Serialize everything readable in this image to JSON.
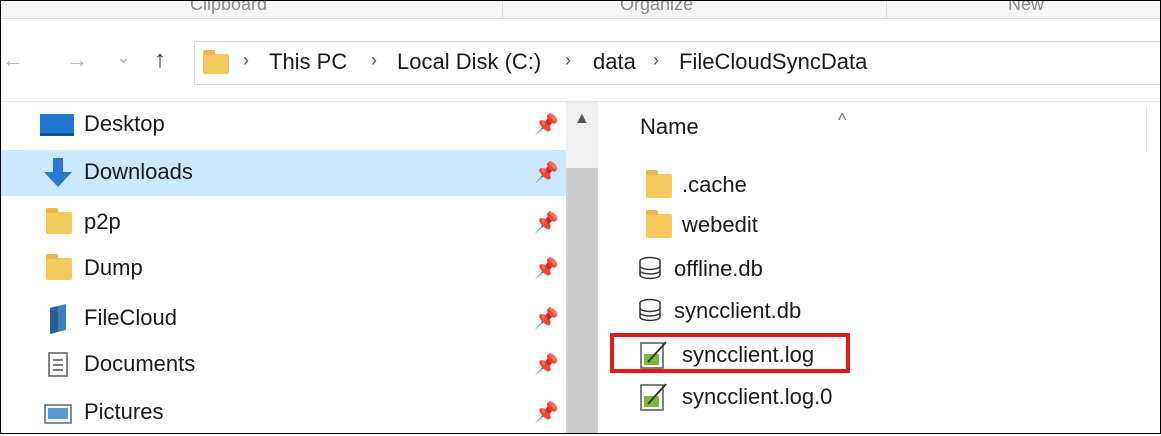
{
  "ribbon": {
    "groups": [
      "Clipboard",
      "Organize",
      "New"
    ]
  },
  "address_bar": {
    "crumbs": [
      "This PC",
      "Local Disk (C:)",
      "data",
      "FileCloudSyncData"
    ],
    "separator": "›"
  },
  "nav": {
    "back_icon": "←",
    "forward_icon": "→",
    "recent_icon": "⌄",
    "up_icon": "↑",
    "pin_glyph": "📌",
    "items": [
      {
        "label": "Desktop",
        "icon": "desktop-icon",
        "pinned": true,
        "selected": false
      },
      {
        "label": "Downloads",
        "icon": "downloads-icon",
        "pinned": true,
        "selected": true
      },
      {
        "label": "p2p",
        "icon": "folder-icon",
        "pinned": true,
        "selected": false
      },
      {
        "label": "Dump",
        "icon": "folder-icon",
        "pinned": true,
        "selected": false
      },
      {
        "label": "FileCloud",
        "icon": "filecloud-icon",
        "pinned": true,
        "selected": false
      },
      {
        "label": "Documents",
        "icon": "documents-icon",
        "pinned": true,
        "selected": false
      },
      {
        "label": "Pictures",
        "icon": "pictures-icon",
        "pinned": true,
        "selected": false
      }
    ]
  },
  "filelist": {
    "column_name": "Name",
    "sort_caret": "^",
    "items": [
      {
        "label": ".cache",
        "type": "folder"
      },
      {
        "label": "webedit",
        "type": "folder"
      },
      {
        "label": "offline.db",
        "type": "db"
      },
      {
        "label": "syncclient.db",
        "type": "db"
      },
      {
        "label": "syncclient.log",
        "type": "log",
        "highlighted": true
      },
      {
        "label": "syncclient.log.0",
        "type": "log"
      }
    ]
  },
  "colors": {
    "selection": "#cce8ff",
    "folder": "#f3c95b",
    "highlight": "#e11a1a"
  }
}
